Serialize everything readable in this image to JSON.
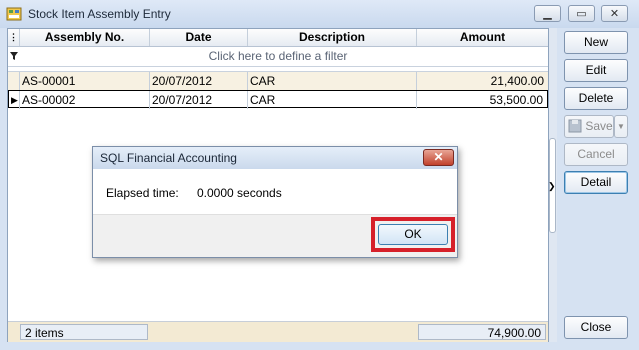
{
  "window": {
    "title": "Stock Item Assembly Entry"
  },
  "grid": {
    "columns": [
      "Assembly No.",
      "Date",
      "Description",
      "Amount"
    ],
    "filter_hint": "Click here to define a filter",
    "rows": [
      {
        "no": "AS-00001",
        "date": "20/07/2012",
        "description": "CAR",
        "amount": "21,400.00"
      },
      {
        "no": "AS-00002",
        "date": "20/07/2012",
        "description": "CAR",
        "amount": "53,500.00"
      }
    ],
    "footer": {
      "count": "2 items",
      "total": "74,900.00"
    }
  },
  "buttons": {
    "new": "New",
    "edit": "Edit",
    "delete": "Delete",
    "save": "Save",
    "cancel": "Cancel",
    "detail": "Detail",
    "close": "Close"
  },
  "dialog": {
    "title": "SQL Financial Accounting",
    "label": "Elapsed time:",
    "value": "0.0000 seconds",
    "ok": "OK"
  },
  "colors": {
    "highlight_frame": "#d6202a",
    "selected_row": "#f7f1e2"
  }
}
